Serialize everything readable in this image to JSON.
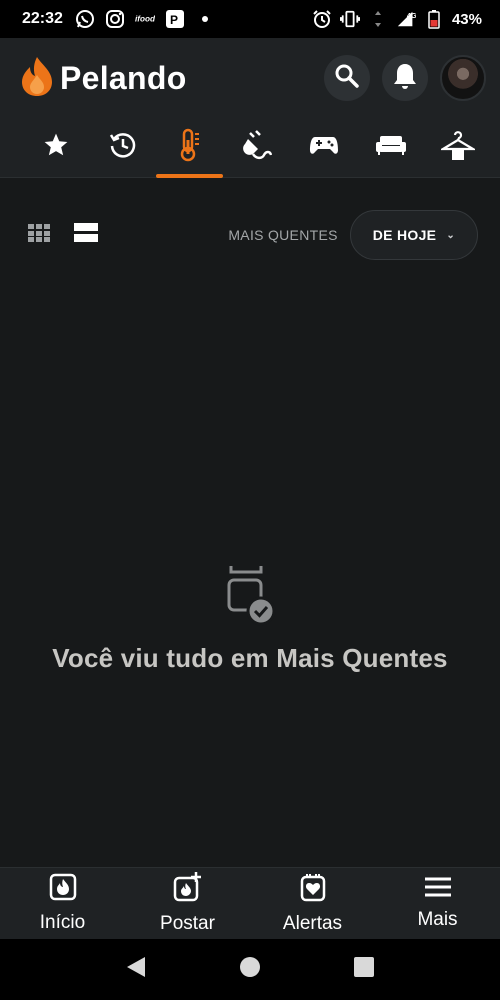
{
  "status_bar": {
    "time": "22:32",
    "network": "4G",
    "battery": "43%",
    "left_icons": [
      "whatsapp-icon",
      "instagram-icon",
      "ifood-icon",
      "picpay-icon",
      "dot-icon"
    ],
    "right_icons": [
      "alarm-icon",
      "vibrate-icon",
      "data-arrows-icon",
      "signal-icon",
      "battery-icon"
    ]
  },
  "header": {
    "app_name": "Pelando",
    "actions": [
      "search-icon",
      "bell-icon",
      "avatar"
    ]
  },
  "categories": {
    "active_index": 2,
    "items": [
      "star-icon",
      "clock-refresh-icon",
      "thermometer-icon",
      "plug-icon",
      "gamepad-icon",
      "sofa-icon",
      "hanger-icon"
    ]
  },
  "toolbar": {
    "sort_label": "MAIS QUENTES",
    "period": "DE HOJE"
  },
  "empty_state": {
    "message": "Você viu tudo em Mais Quentes"
  },
  "bottom_nav": {
    "items": [
      {
        "label": "Início",
        "icon": "home-flame-icon"
      },
      {
        "label": "Postar",
        "icon": "post-add-icon"
      },
      {
        "label": "Alertas",
        "icon": "alerts-icon"
      },
      {
        "label": "Mais",
        "icon": "menu-icon"
      }
    ]
  },
  "colors": {
    "accent": "#ec7418",
    "background": "#17191a",
    "surface": "#1f2224"
  }
}
